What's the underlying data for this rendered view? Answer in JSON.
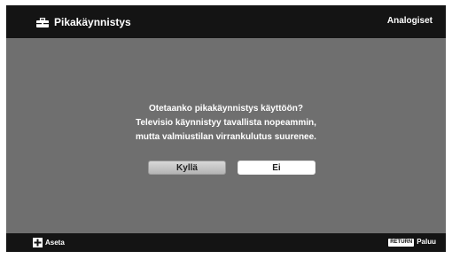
{
  "header": {
    "title": "Pikakäynnistys",
    "title_icon": "toolbox-icon",
    "mode_label": "Analogiset"
  },
  "dialog": {
    "lines": [
      "Otetaanko pikakäynnistys käyttöön?",
      "Televisio käynnistyy tavallista nopeammin,",
      "mutta valmiustilan virrankulutus suurenee."
    ],
    "buttons": {
      "yes": "Kyllä",
      "no": "Ei"
    },
    "focused_button": "no"
  },
  "footer": {
    "set_icon": "plus-icon",
    "set_label": "Aseta",
    "return_key": "RETURN",
    "return_label": "Paluu"
  },
  "colors": {
    "background": "#6f6f6f",
    "bars": "#141414",
    "text": "#ffffff"
  }
}
